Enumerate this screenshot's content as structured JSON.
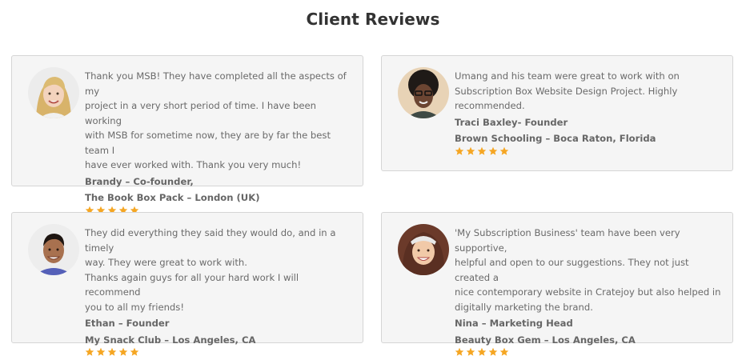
{
  "heading": "Client Reviews",
  "colors": {
    "star": "#f5a623",
    "card_bg": "#f5f5f5",
    "card_border": "#d5d5d5"
  },
  "reviews": [
    {
      "lines": [
        "Thank you MSB! They have completed all the aspects of my",
        "project in a very short period of time. I have been working",
        "with MSB for sometime now, they are by far the best team I",
        "have ever worked with. Thank you very much!"
      ],
      "name": "Brandy – Co-founder,",
      "company": "The Book Box Pack – London (UK)",
      "rating": 5
    },
    {
      "lines": [
        "Umang and his team were great to work with on",
        "Subscription Box Website Design Project. Highly",
        "recommended."
      ],
      "name": "Traci Baxley- Founder",
      "company": "Brown Schooling – Boca Raton, Florida",
      "rating": 5
    },
    {
      "lines": [
        "They did everything they said they would do, and in a timely",
        "way. They were great to work with.",
        "Thanks again guys for all your hard work I will recommend",
        "you to all my friends!"
      ],
      "name": "Ethan – Founder",
      "company": "My Snack Club – Los Angeles, CA",
      "rating": 5
    },
    {
      "lines": [
        "'My Subscription Business' team have been very supportive,",
        "helpful and open to our suggestions. They not just created a",
        "nice contemporary website in Cratejoy but also helped in",
        "digitally marketing the brand."
      ],
      "name": "Nina – Marketing Head",
      "company": "Beauty Box Gem – Los Angeles, CA",
      "rating": 5
    }
  ]
}
